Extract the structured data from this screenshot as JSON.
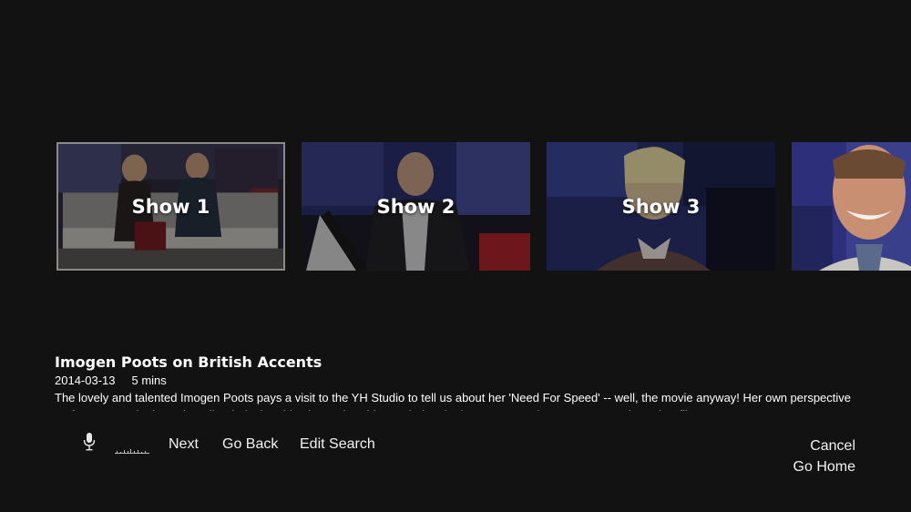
{
  "carousel": {
    "tiles": [
      {
        "label": "Show 1",
        "selected": true
      },
      {
        "label": "Show 2",
        "selected": false
      },
      {
        "label": "Show 3",
        "selected": false
      },
      {
        "label": "",
        "selected": false
      }
    ]
  },
  "video": {
    "title": "Imogen Poots on British Accents",
    "date": "2014-03-13",
    "duration": "5 mins",
    "description": "The lovely and talented Imogen Poots pays a visit to the YH Studio to tell us about her 'Need For Speed' -- well, the movie anyway! Her own perspective on fast cars and other adrenaline-inducing rides is another thing entirely! The busy actress also scoops us on her other film"
  },
  "voice_bar": {
    "mic_icon": "microphone-icon",
    "meter_icon": "audio-level-meter",
    "commands": {
      "next": "Next",
      "go_back": "Go Back",
      "edit_search": "Edit Search",
      "cancel": "Cancel",
      "go_home": "Go Home"
    }
  },
  "colors": {
    "background": "#121212",
    "selected_border": "#8a8a8a",
    "text": "#ffffff"
  }
}
